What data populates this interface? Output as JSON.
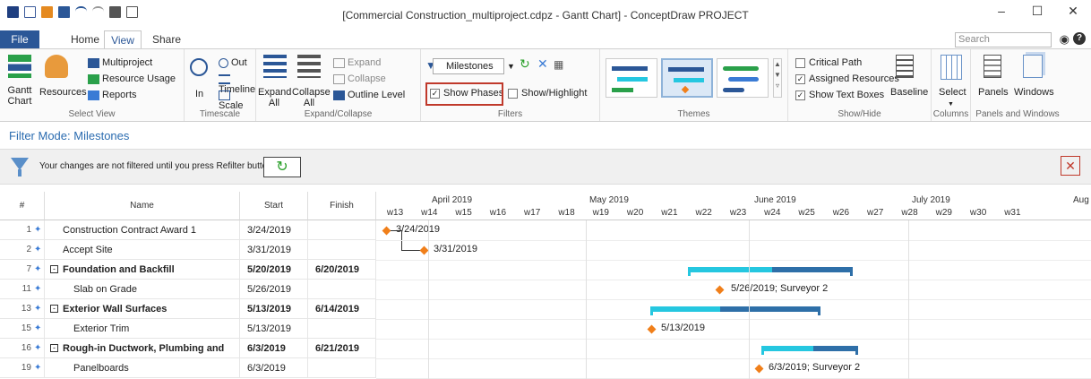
{
  "window": {
    "title": "[Commercial Construction_multiproject.cdpz - Gantt Chart] - ConceptDraw PROJECT",
    "controls": [
      "–",
      "☐",
      "✕"
    ]
  },
  "tabs": {
    "file": "File",
    "home": "Home",
    "view": "View",
    "share": "Share"
  },
  "search": {
    "placeholder": "Search"
  },
  "ribbon": {
    "select_view": {
      "label": "Select View",
      "gantt_chart": "Gantt Chart",
      "resources": "Resources",
      "multiproject": "Multiproject",
      "resource_usage": "Resource Usage",
      "reports": "Reports"
    },
    "timescale": {
      "label": "Timescale",
      "in": "In",
      "out": "Out",
      "timeline": "Timeline",
      "scale": "Scale"
    },
    "expand_collapse": {
      "label": "Expand/Collapse",
      "expand_all": "Expand All",
      "collapse_all": "Collapse All",
      "expand": "Expand",
      "collapse": "Collapse",
      "outline_level": "Outline Level"
    },
    "filters": {
      "label": "Filters",
      "selected": "Milestones",
      "show_phases": "Show Phases",
      "show_highlight": "Show/Highlight"
    },
    "themes": {
      "label": "Themes"
    },
    "show_hide": {
      "label": "Show/Hide",
      "critical_path": "Critical Path",
      "assigned_resources": "Assigned Resources",
      "show_text_boxes": "Show Text Boxes",
      "baseline": "Baseline"
    },
    "columns": {
      "label": "Columns",
      "select": "Select"
    },
    "panels": {
      "label": "Panels and Windows",
      "panels": "Panels",
      "windows": "Windows"
    }
  },
  "filter_mode": "Filter Mode: Milestones",
  "notice": {
    "text": "Your changes are not filtered until you press Refilter button"
  },
  "table": {
    "headers": {
      "num": "#",
      "name": "Name",
      "start": "Start",
      "finish": "Finish"
    },
    "rows": [
      {
        "num": "1",
        "name": "Construction Contract Award 1",
        "start": "3/24/2019",
        "finish": "",
        "bold": false,
        "indent": 0,
        "summary": false
      },
      {
        "num": "2",
        "name": "Accept Site",
        "start": "3/31/2019",
        "finish": "",
        "bold": false,
        "indent": 0,
        "summary": false
      },
      {
        "num": "7",
        "name": "Foundation and Backfill",
        "start": "5/20/2019",
        "finish": "6/20/2019",
        "bold": true,
        "indent": 0,
        "summary": true
      },
      {
        "num": "11",
        "name": "Slab on Grade",
        "start": "5/26/2019",
        "finish": "",
        "bold": false,
        "indent": 1,
        "summary": false
      },
      {
        "num": "13",
        "name": "Exterior Wall Surfaces",
        "start": "5/13/2019",
        "finish": "6/14/2019",
        "bold": true,
        "indent": 0,
        "summary": true
      },
      {
        "num": "15",
        "name": "Exterior Trim",
        "start": "5/13/2019",
        "finish": "",
        "bold": false,
        "indent": 1,
        "summary": false
      },
      {
        "num": "16",
        "name": "Rough-in Ductwork, Plumbing and",
        "start": "6/3/2019",
        "finish": "6/21/2019",
        "bold": true,
        "indent": 0,
        "summary": true
      },
      {
        "num": "19",
        "name": "Panelboards",
        "start": "6/3/2019",
        "finish": "",
        "bold": false,
        "indent": 1,
        "summary": false
      }
    ]
  },
  "timeline": {
    "months": [
      "April 2019",
      "May 2019",
      "June 2019",
      "July 2019",
      "Aug"
    ],
    "weeks": [
      "w13",
      "w14",
      "w15",
      "w16",
      "w17",
      "w18",
      "w19",
      "w20",
      "w21",
      "w22",
      "w23",
      "w24",
      "w25",
      "w26",
      "w27",
      "w28",
      "w29",
      "w30",
      "w31"
    ]
  },
  "gantt_labels": {
    "row1": "3/24/2019",
    "row2": "3/31/2019",
    "row4": "5/26/2019; Surveyor 2",
    "row6": "5/13/2019",
    "row8": "6/3/2019; Surveyor 2"
  }
}
